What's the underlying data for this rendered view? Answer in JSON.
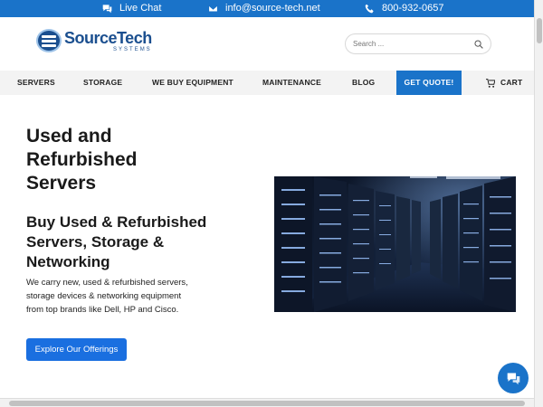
{
  "topbar": {
    "live_chat": "Live Chat",
    "email": "info@source-tech.net",
    "phone": "800-932-0657"
  },
  "logo": {
    "name": "SourceTech",
    "sub": "SYSTEMS"
  },
  "search": {
    "placeholder": "Search ..."
  },
  "nav": {
    "items": [
      "SERVERS",
      "STORAGE",
      "WE BUY EQUIPMENT",
      "MAINTENANCE",
      "BLOG"
    ],
    "quote": "GET QUOTE!",
    "cart": "CART"
  },
  "hero": {
    "title": "Used and Refurbished Servers",
    "subtitle": "Buy Used & Refurbished Servers, Storage & Networking",
    "description": "We carry new, used & refurbished servers, storage devices & networking equipment from top brands like Dell, HP and Cisco.",
    "cta": "Explore Our Offerings"
  },
  "colors": {
    "primary": "#1a73c9",
    "button": "#1a6fe0",
    "logo": "#1b4f8f"
  }
}
